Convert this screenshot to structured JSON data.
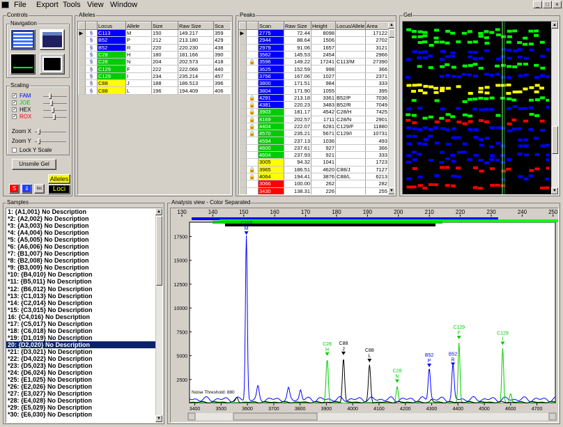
{
  "menu": [
    "File",
    "Export",
    "Tools",
    "View",
    "Window"
  ],
  "window_buttons": [
    "_",
    "□",
    "×"
  ],
  "colors": {
    "blue": "#0000ff",
    "green": "#00cc00",
    "yellow": "#ffff00",
    "black": "#000000",
    "red": "#ff0000",
    "selection": "#0a246a"
  },
  "controls": {
    "title": "Controls",
    "navigation_label": "Navigation",
    "scaling_label": "Scaling",
    "dyes": [
      {
        "name": "FAM",
        "color": "#0000ff",
        "checked": true
      },
      {
        "name": "JOE",
        "color": "#00cc00",
        "checked": true
      },
      {
        "name": "HEX",
        "color": "#000000",
        "checked": true
      },
      {
        "name": "ROX",
        "color": "#ff0000",
        "checked": true
      }
    ],
    "zoom_x_label": "Zoom X",
    "zoom_y_label": "Zoom Y",
    "lock_y_label": "Lock Y Scale",
    "unsmile_label": "Unsmile Gel",
    "alleles_label": "Alleles",
    "loci_label": "Loci"
  },
  "alleles": {
    "title": "Alleles",
    "columns": [
      "Locus",
      "Allele",
      "Size",
      "Raw Size",
      "Sca"
    ],
    "rows": [
      {
        "locus": "C113",
        "color": "#0000ff",
        "allele": "M",
        "size": "150",
        "raw": "149.217",
        "sca": "359"
      },
      {
        "locus": "B52",
        "color": "#0000ff",
        "allele": "P",
        "size": "212",
        "raw": "213.180",
        "sca": "429"
      },
      {
        "locus": "B52",
        "color": "#0000ff",
        "allele": "R",
        "size": "220",
        "raw": "220.230",
        "sca": "438"
      },
      {
        "locus": "C28",
        "color": "#00cc00",
        "allele": "H",
        "size": "180",
        "raw": "181.166",
        "sca": "390"
      },
      {
        "locus": "C28",
        "color": "#00cc00",
        "allele": "N",
        "size": "204",
        "raw": "202.573",
        "sca": "418"
      },
      {
        "locus": "C129",
        "color": "#00cc00",
        "allele": "F",
        "size": "222",
        "raw": "222.066",
        "sca": "440"
      },
      {
        "locus": "C129",
        "color": "#00cc00",
        "allele": "I",
        "size": "234",
        "raw": "235.214",
        "sca": "457"
      },
      {
        "locus": "C88",
        "color": "#ffff00",
        "allele": "J",
        "size": "188",
        "raw": "186.513",
        "sca": "396"
      },
      {
        "locus": "C88",
        "color": "#ffff00",
        "allele": "L",
        "size": "196",
        "raw": "194.409",
        "sca": "406"
      }
    ]
  },
  "peaks": {
    "title": "Peaks",
    "columns": [
      "Scan",
      "Raw Size",
      "Height",
      "Locus/Allele",
      "Area"
    ],
    "rows": [
      {
        "scan": "2775",
        "color": "#0000ff",
        "raw": "72.44",
        "height": "8098",
        "la": "",
        "area": "17122",
        "lock": false
      },
      {
        "scan": "2944",
        "color": "#0000ff",
        "raw": "88.64",
        "height": "1506",
        "la": "",
        "area": "2702",
        "lock": false
      },
      {
        "scan": "2979",
        "color": "#0000ff",
        "raw": "91.06",
        "height": "1657",
        "la": "",
        "area": "3121",
        "lock": false
      },
      {
        "scan": "3562",
        "color": "#0000ff",
        "raw": "145.53",
        "height": "2454",
        "la": "",
        "area": "2966",
        "lock": false
      },
      {
        "scan": "3596",
        "color": "#0000ff",
        "raw": "149.22",
        "height": "17241",
        "la": "C113/M",
        "area": "27390",
        "lock": true
      },
      {
        "scan": "3625",
        "color": "#0000ff",
        "raw": "152.59",
        "height": "998",
        "la": "",
        "area": "366",
        "lock": false
      },
      {
        "scan": "3756",
        "color": "#0000ff",
        "raw": "167.06",
        "height": "1027",
        "la": "",
        "area": "2371",
        "lock": false
      },
      {
        "scan": "3800",
        "color": "#0000ff",
        "raw": "171.51",
        "height": "984",
        "la": "",
        "area": "333",
        "lock": false
      },
      {
        "scan": "3804",
        "color": "#0000ff",
        "raw": "171.90",
        "height": "1055",
        "la": "",
        "area": "395",
        "lock": false
      },
      {
        "scan": "4291",
        "color": "#0000ff",
        "raw": "213.18",
        "height": "3361",
        "la": "B52/P",
        "area": "7036",
        "lock": true
      },
      {
        "scan": "4381",
        "color": "#0000ff",
        "raw": "220.23",
        "height": "3483",
        "la": "B52/R",
        "area": "7049",
        "lock": true
      },
      {
        "scan": "3903",
        "color": "#00cc00",
        "raw": "181.17",
        "height": "4542",
        "la": "C28/H",
        "area": "7425",
        "lock": true
      },
      {
        "scan": "4169",
        "color": "#00cc00",
        "raw": "202.57",
        "height": "1711",
        "la": "C28/N",
        "area": "2901",
        "lock": true
      },
      {
        "scan": "4404",
        "color": "#00cc00",
        "raw": "222.07",
        "height": "6281",
        "la": "C129/F",
        "area": "11880",
        "lock": true
      },
      {
        "scan": "4570",
        "color": "#00cc00",
        "raw": "235.21",
        "height": "5671",
        "la": "C129/I",
        "area": "10731",
        "lock": true
      },
      {
        "scan": "4594",
        "color": "#00cc00",
        "raw": "237.13",
        "height": "1036",
        "la": "",
        "area": "493",
        "lock": false
      },
      {
        "scan": "4600",
        "color": "#00cc00",
        "raw": "237.61",
        "height": "927",
        "la": "",
        "area": "366",
        "lock": false
      },
      {
        "scan": "4604",
        "color": "#00cc00",
        "raw": "237.93",
        "height": "921",
        "la": "",
        "area": "333",
        "lock": false
      },
      {
        "scan": "3005",
        "color": "#ffff00",
        "raw": "94.32",
        "height": "1041",
        "la": "",
        "area": "1723",
        "lock": false
      },
      {
        "scan": "3965",
        "color": "#ffff00",
        "raw": "186.51",
        "height": "4620",
        "la": "C88/J",
        "area": "7127",
        "lock": true
      },
      {
        "scan": "4064",
        "color": "#ffff00",
        "raw": "194.41",
        "height": "3876",
        "la": "C88/L",
        "area": "6213",
        "lock": true
      },
      {
        "scan": "3066",
        "color": "#ff0000",
        "raw": "100.00",
        "height": "262",
        "la": "",
        "area": "282",
        "lock": false
      },
      {
        "scan": "3430",
        "color": "#ff0000",
        "raw": "138.31",
        "height": "226",
        "la": "",
        "area": "255",
        "lock": false
      }
    ]
  },
  "gel": {
    "title": "Gel"
  },
  "samples": {
    "title": "Samples",
    "selected_index": 19,
    "items": [
      "1: {A1,001}  No Description",
      "*2: {A2,002}  No Description",
      "*3: {A3,003}  No Description",
      "*4: {A4,004}  No Description",
      "*5: {A5,005}  No Description",
      "*6: {A6,006}  No Description",
      "*7: {B1,007}  No Description",
      "*8: {B2,008}  No Description",
      "*9: {B3,009}  No Description",
      "*10: {B4,010}  No Description",
      "*11: {B5,011}  No Description",
      "*12: {B6,012}  No Description",
      "*13: {C1,013}  No Description",
      "*14: {C2,014}  No Description",
      "*15: {C3,015}  No Description",
      "16: {C4,016}  No Description",
      "*17: {C5,017}  No Description",
      "*18: {C6,018}  No Description",
      "*19: {D1,019}  No Description",
      "20: {D2,020}  No Description",
      "*21: {D3,021}  No Description",
      "*22: {D4,022}  No Description",
      "*23: {D5,023}  No Description",
      "*24: {D6,024}  No Description",
      "*25: {E1,025}  No Description",
      "*26: {E2,026}  No Description",
      "*27: {E3,027}  No Description",
      "*28: {E4,028}  No Description",
      "*29: {E5,029}  No Description",
      "*30: {E6,030}  No Description"
    ]
  },
  "analysis": {
    "title": "Analysis view - Color Separated",
    "noise_label": "Noise Threshold: 880"
  },
  "chart_data": {
    "type": "line",
    "x_scan_range": [
      3380,
      4770
    ],
    "x_scan_ticks": [
      3400,
      3500,
      3600,
      3700,
      3800,
      3900,
      4000,
      4100,
      4200,
      4300,
      4400,
      4500,
      4600,
      4700
    ],
    "size_ticks": [
      130,
      140,
      150,
      160,
      170,
      180,
      190,
      200,
      210,
      220,
      230,
      240,
      250
    ],
    "ylim": [
      0,
      19000
    ],
    "y_ticks": [
      2500,
      5000,
      7500,
      10000,
      12500,
      15000,
      17500
    ],
    "noise_threshold": 880,
    "series": [
      {
        "color": "#0000ff",
        "peaks": [
          [
            3350,
            0.4
          ],
          [
            3460,
            1.5
          ],
          [
            3520,
            2.5
          ],
          [
            3575,
            5
          ],
          [
            3596,
            17200
          ],
          [
            3640,
            1200
          ],
          [
            3756,
            1000
          ],
          [
            3802,
            1000
          ],
          [
            4291,
            3361
          ],
          [
            4381,
            3483
          ]
        ],
        "base": 700
      },
      {
        "color": "#00cc00",
        "peaks": [
          [
            3903,
            4542
          ],
          [
            4169,
            1711
          ],
          [
            4404,
            6281
          ],
          [
            4570,
            5671
          ],
          [
            4600,
            950
          ]
        ],
        "base": 100
      },
      {
        "color": "#000000",
        "peaks": [
          [
            3560,
            500
          ],
          [
            3965,
            4620
          ],
          [
            4064,
            3876
          ],
          [
            4300,
            280
          ]
        ],
        "base": 200
      }
    ],
    "labels": [
      {
        "scan": 3596,
        "size": "149",
        "locus": "C113",
        "allele": "M",
        "color": "#0000ff",
        "height": 17241
      },
      {
        "scan": 3903,
        "locus": "C28",
        "allele": "H",
        "color": "#00cc00",
        "height": 4542
      },
      {
        "scan": 3965,
        "locus": "C88",
        "allele": "J",
        "color": "#000000",
        "height": 4620
      },
      {
        "scan": 4064,
        "locus": "C88",
        "allele": "L",
        "color": "#000000",
        "height": 3876
      },
      {
        "scan": 4169,
        "locus": "C28",
        "allele": "N",
        "color": "#00cc00",
        "height": 1711
      },
      {
        "scan": 4291,
        "locus": "B52",
        "allele": "P",
        "color": "#0000ff",
        "height": 3361
      },
      {
        "scan": 4381,
        "locus": "B52",
        "allele": "R",
        "color": "#0000ff",
        "height": 3483
      },
      {
        "scan": 4404,
        "locus": "C129",
        "allele": "F",
        "color": "#00cc00",
        "height": 6281
      },
      {
        "scan": 4570,
        "locus": "C129",
        "allele": "I",
        "color": "#00cc00",
        "height": 5671
      }
    ]
  }
}
